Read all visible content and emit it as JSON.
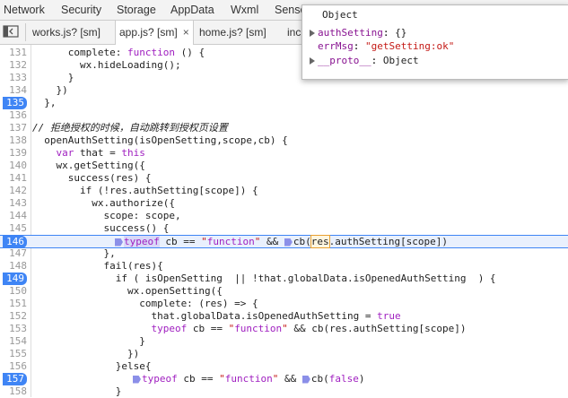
{
  "panel_tabs": [
    "Network",
    "Security",
    "Storage",
    "AppData",
    "Wxml",
    "Senso"
  ],
  "file_tabs": [
    {
      "label": "works.js? [sm]",
      "active": false,
      "closable": false
    },
    {
      "label": "app.js? [sm]",
      "active": true,
      "closable": true,
      "close": "×"
    },
    {
      "label": "home.js? [sm]",
      "active": false,
      "closable": false
    },
    {
      "label": "inc",
      "active": false,
      "closable": false
    }
  ],
  "popup": {
    "title": "Object",
    "rows": [
      {
        "key": "authSetting",
        "sep": ": ",
        "value": "{}",
        "expandable": true
      },
      {
        "key": "errMsg",
        "sep": ": ",
        "value": "\"getSetting:ok\"",
        "expandable": false
      },
      {
        "key": "__proto__",
        "sep": ": ",
        "value": "Object",
        "expandable": true
      }
    ]
  },
  "lines": [
    {
      "n": "131",
      "code": "      complete: function () {"
    },
    {
      "n": "132",
      "code": "        wx.hideLoading();"
    },
    {
      "n": "133",
      "code": "      }"
    },
    {
      "n": "134",
      "code": "    })"
    },
    {
      "n": "135",
      "code": "  },",
      "breakpoint": true
    },
    {
      "n": "136",
      "code": ""
    },
    {
      "n": "137",
      "code": "// 拒绝授权的时候，自动跳转到授权页设置",
      "comment": true
    },
    {
      "n": "138",
      "code": "  openAuthSetting(isOpenSetting,scope,cb) {"
    },
    {
      "n": "139",
      "code": "    var that = this"
    },
    {
      "n": "140",
      "code": "    wx.getSetting({"
    },
    {
      "n": "141",
      "code": "      success(res) {"
    },
    {
      "n": "142",
      "code": "        if (!res.authSetting[scope]) {"
    },
    {
      "n": "143",
      "code": "          wx.authorize({"
    },
    {
      "n": "144",
      "code": "            scope: scope,"
    },
    {
      "n": "145",
      "code": "            success() {"
    },
    {
      "n": "146",
      "code": "typeof cb == \"function\" && cb(res.authSetting[scope])",
      "breakpoint": true,
      "exec": true
    },
    {
      "n": "147",
      "code": "            },"
    },
    {
      "n": "148",
      "code": "            fail(res){"
    },
    {
      "n": "149",
      "code": "              if ( isOpenSetting  || !that.globalData.isOpenedAuthSetting  ) {",
      "breakpoint": true
    },
    {
      "n": "150",
      "code": "                wx.openSetting({"
    },
    {
      "n": "151",
      "code": "                  complete: (res) => {"
    },
    {
      "n": "152",
      "code": "                    that.globalData.isOpenedAuthSetting = true"
    },
    {
      "n": "153",
      "code": "                    typeof cb == \"function\" && cb(res.authSetting[scope])"
    },
    {
      "n": "154",
      "code": "                  }"
    },
    {
      "n": "155",
      "code": "                })"
    },
    {
      "n": "156",
      "code": "              }else{"
    },
    {
      "n": "157",
      "code": "typeof cb == \"function\" && cb(false)",
      "breakpoint": true
    },
    {
      "n": "158",
      "code": "              }"
    }
  ]
}
